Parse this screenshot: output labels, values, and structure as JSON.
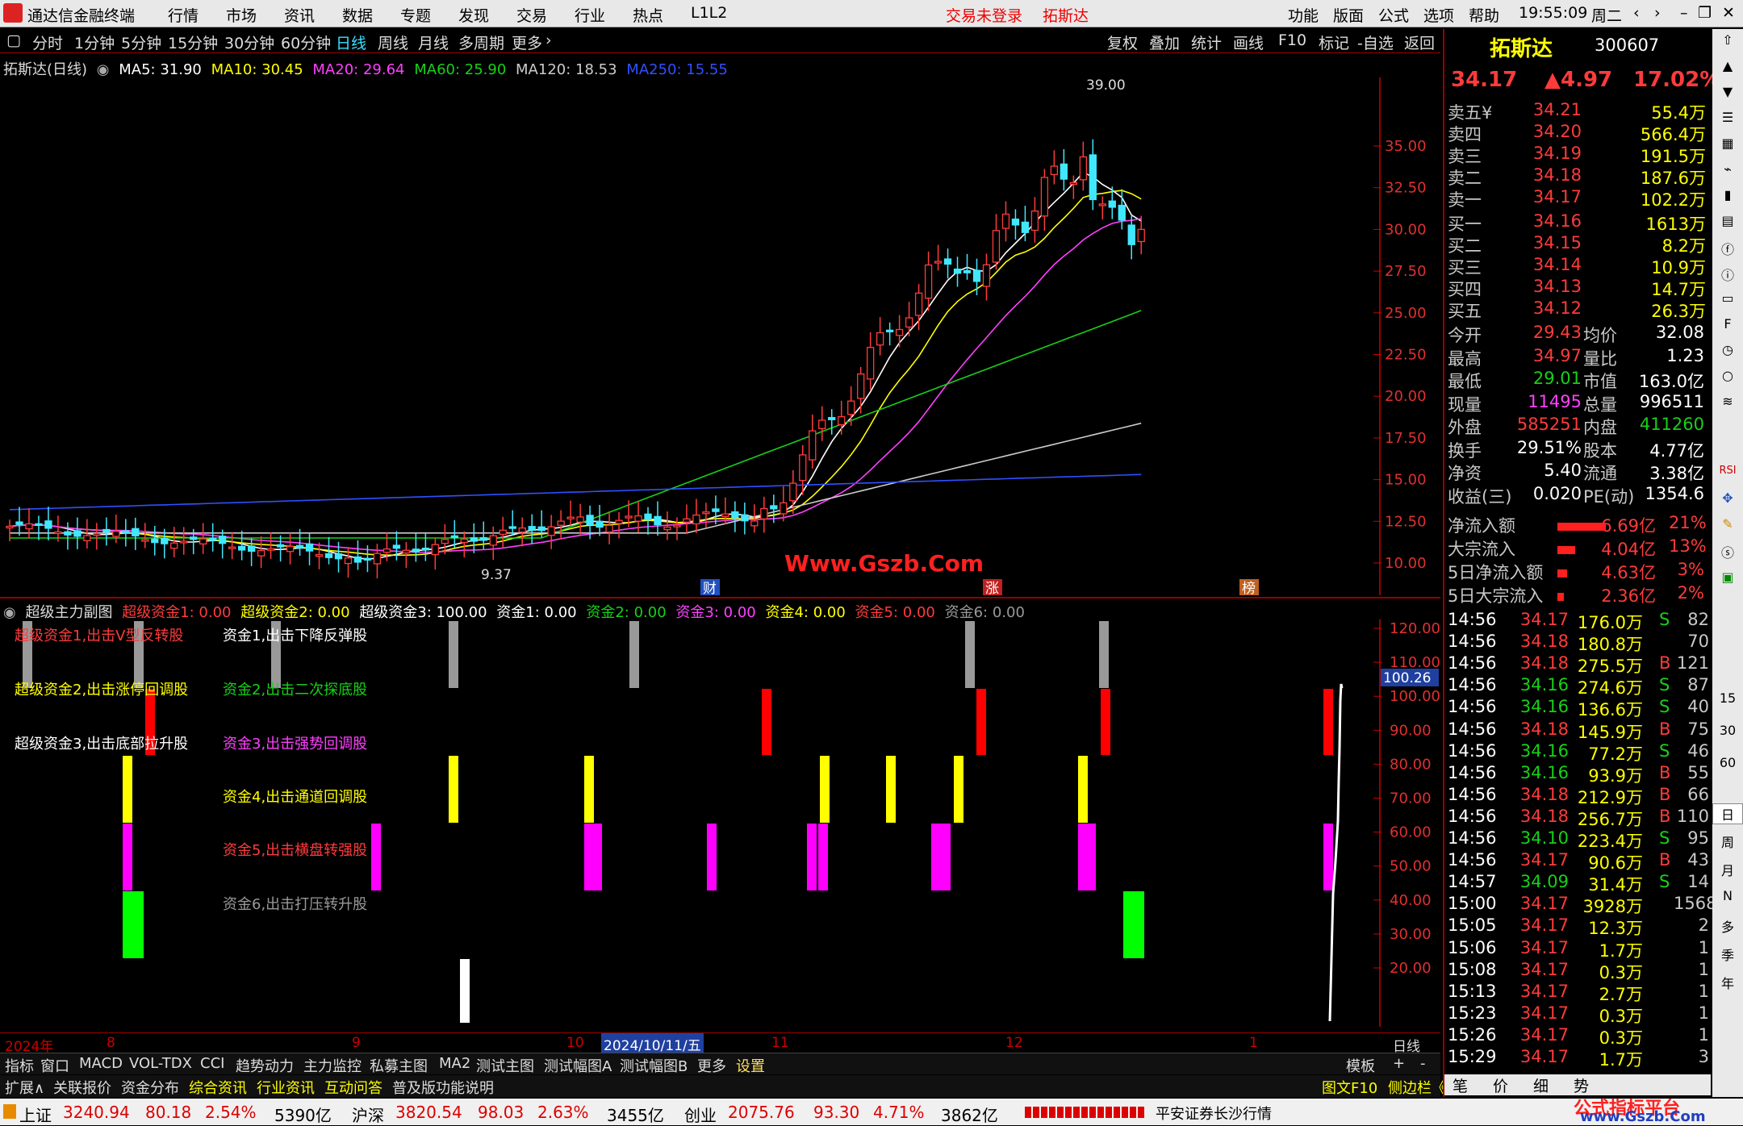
{
  "titlebar": {
    "app": "通达信金融终端",
    "menus": [
      "行情",
      "市场",
      "资讯",
      "数据",
      "专题",
      "发现",
      "交易",
      "行业",
      "热点",
      "L1L2"
    ],
    "alert": "交易未登录",
    "stock": "拓斯达",
    "right_menus": [
      "功能",
      "版面",
      "公式",
      "选项",
      "帮助"
    ],
    "time": "19:55:09",
    "weekday": "周二"
  },
  "periods": [
    "分时",
    "1分钟",
    "5分钟",
    "15分钟",
    "30分钟",
    "60分钟",
    "日线",
    "周线",
    "月线",
    "多周期",
    "更多"
  ],
  "toolbar_right": [
    "复权",
    "叠加",
    "统计",
    "画线",
    "F10",
    "标记",
    "-自选",
    "返回"
  ],
  "ma_legend": {
    "name": "拓斯达(日线)",
    "ma5": "MA5: 31.90",
    "ma10": "MA10: 30.45",
    "ma20": "MA20: 29.64",
    "ma60": "MA60: 25.90",
    "ma120": "MA120: 18.53",
    "ma250": "MA250: 15.55"
  },
  "price_axis": [
    "35.00",
    "32.50",
    "30.00",
    "27.50",
    "25.00",
    "22.50",
    "20.00",
    "17.50",
    "15.00",
    "12.50",
    "10.00"
  ],
  "high_label": "39.00",
  "low_label": "9.37",
  "watermark": "Www.Gszb.Com",
  "markers": [
    "财",
    "涨",
    "榜"
  ],
  "sub_legend": {
    "name": "超级主力副图",
    "items": [
      "超级资金1: 0.00",
      "超级资金2: 0.00",
      "超级资金3: 100.00",
      "资金1: 0.00",
      "资金2: 0.00",
      "资金3: 0.00",
      "资金4: 0.00",
      "资金5: 0.00",
      "资金6: 0.00"
    ]
  },
  "sub_labels": {
    "l1": "超级资金1,出击V型反转股",
    "l2": "超级资金2,出击涨停回调股",
    "l3": "超级资金3,出击底部拉升股",
    "r1": "资金1,出击下降反弹股",
    "r2": "资金2,出击二次探底股",
    "r3": "资金3,出击强势回调股",
    "r4": "资金4,出击通道回调股",
    "r5": "资金5,出击横盘转强股",
    "r6": "资金6,出击打压转升股"
  },
  "sub_axis": [
    "120.00",
    "110.00",
    "100.00",
    "90.00",
    "80.00",
    "70.00",
    "60.00",
    "50.00",
    "40.00",
    "30.00",
    "20.00"
  ],
  "sub_value": "100.26",
  "date_axis": {
    "year": "2024年",
    "m8": "8",
    "m9": "9",
    "m10": "10",
    "cursor": "2024/10/11/五",
    "m11": "11",
    "m12": "12",
    "m1": "1",
    "period": "日线"
  },
  "tabs1": [
    "指标",
    "窗口",
    "MACD",
    "VOL-TDX",
    "CCI",
    "趋势动力",
    "主力监控",
    "私募主图",
    "MA2",
    "测试主图",
    "测试幅图A",
    "测试幅图B",
    "更多",
    "设置"
  ],
  "tabs1_right": [
    "模板",
    "+",
    "-"
  ],
  "tabs2": [
    "扩展∧",
    "关联报价",
    "资金分布",
    "综合资讯",
    "行业资讯",
    "互动问答",
    "普及版功能说明"
  ],
  "tabs2_right": [
    "图文F10",
    "侧边栏《"
  ],
  "quote": {
    "name": "拓斯达",
    "code": "300607",
    "price": "34.17",
    "change": "▲4.97",
    "pct": "17.02%",
    "asks": [
      [
        "卖五¥",
        "34.21",
        "55.4万"
      ],
      [
        "卖四",
        "34.20",
        "566.4万"
      ],
      [
        "卖三",
        "34.19",
        "191.5万"
      ],
      [
        "卖二",
        "34.18",
        "187.6万"
      ],
      [
        "卖一",
        "34.17",
        "102.2万"
      ]
    ],
    "bids": [
      [
        "买一",
        "34.16",
        "1613万"
      ],
      [
        "买二",
        "34.15",
        "8.2万"
      ],
      [
        "买三",
        "34.14",
        "10.9万"
      ],
      [
        "买四",
        "34.13",
        "14.7万"
      ],
      [
        "买五",
        "34.12",
        "26.3万"
      ]
    ],
    "stats": [
      [
        "今开",
        "29.43",
        "均价",
        "32.08"
      ],
      [
        "最高",
        "34.97",
        "量比",
        "1.23"
      ],
      [
        "最低",
        "29.01",
        "市值",
        "163.0亿"
      ],
      [
        "现量",
        "11495",
        "总量",
        "996511"
      ],
      [
        "外盘",
        "585251",
        "内盘",
        "411260"
      ],
      [
        "换手",
        "29.51%",
        "股本",
        "4.77亿"
      ],
      [
        "净资",
        "5.40",
        "流通",
        "3.38亿"
      ],
      [
        "收益(三)",
        "0.020",
        "PE(动)",
        "1354.6"
      ]
    ],
    "flows": [
      [
        "净流入额",
        "6.69亿",
        "21%"
      ],
      [
        "大宗流入",
        "4.04亿",
        "13%"
      ],
      [
        "5日净流入额",
        "4.63亿",
        "3%"
      ],
      [
        "5日大宗流入",
        "2.36亿",
        "2%"
      ]
    ],
    "ticks": [
      [
        "14:56",
        "34.17",
        "176.0万",
        "S",
        "82"
      ],
      [
        "14:56",
        "34.18",
        "180.8万",
        "",
        "70"
      ],
      [
        "14:56",
        "34.18",
        "275.5万",
        "B",
        "121"
      ],
      [
        "14:56",
        "34.16",
        "274.6万",
        "S",
        "87"
      ],
      [
        "14:56",
        "34.16",
        "136.6万",
        "S",
        "40"
      ],
      [
        "14:56",
        "34.18",
        "145.9万",
        "B",
        "75"
      ],
      [
        "14:56",
        "34.16",
        "77.2万",
        "S",
        "46"
      ],
      [
        "14:56",
        "34.16",
        "93.9万",
        "B",
        "55"
      ],
      [
        "14:56",
        "34.18",
        "212.9万",
        "B",
        "66"
      ],
      [
        "14:56",
        "34.18",
        "256.7万",
        "B",
        "110"
      ],
      [
        "14:56",
        "34.10",
        "223.4万",
        "S",
        "95"
      ],
      [
        "14:56",
        "34.17",
        "90.6万",
        "B",
        "43"
      ],
      [
        "14:57",
        "34.09",
        "31.4万",
        "S",
        "14"
      ],
      [
        "15:00",
        "34.17",
        "3928万",
        "",
        "1568"
      ],
      [
        "15:05",
        "34.17",
        "12.3万",
        "",
        "2"
      ],
      [
        "15:06",
        "34.17",
        "1.7万",
        "",
        "1"
      ],
      [
        "15:08",
        "34.17",
        "0.3万",
        "",
        "1"
      ],
      [
        "15:13",
        "34.17",
        "2.7万",
        "",
        "1"
      ],
      [
        "15:23",
        "34.17",
        "0.3万",
        "",
        "1"
      ],
      [
        "15:26",
        "34.17",
        "0.3万",
        "",
        "1"
      ],
      [
        "15:29",
        "34.17",
        "1.7万",
        "",
        "3"
      ]
    ],
    "bottom_tabs": [
      "笔",
      "价",
      "细",
      "势"
    ]
  },
  "right_strip": [
    "15",
    "30",
    "60",
    "日",
    "周",
    "月",
    "N",
    "多",
    "季",
    "年"
  ],
  "status": {
    "sh": "上证",
    "sh_v": "3240.94",
    "sh_c": "80.18",
    "sh_p": "2.54%",
    "sh_a": "5390亿",
    "hs": "沪深",
    "hs_v": "3820.54",
    "hs_c": "98.03",
    "hs_p": "2.63%",
    "hs_a": "3455亿",
    "cy": "创业",
    "cy_v": "2075.76",
    "cy_c": "93.30",
    "cy_p": "4.71%",
    "cy_a": "3862亿",
    "broker": "平安证券长沙行情",
    "brand": "公式指标平台",
    "brand_url": "www.Gszb.Com"
  }
}
